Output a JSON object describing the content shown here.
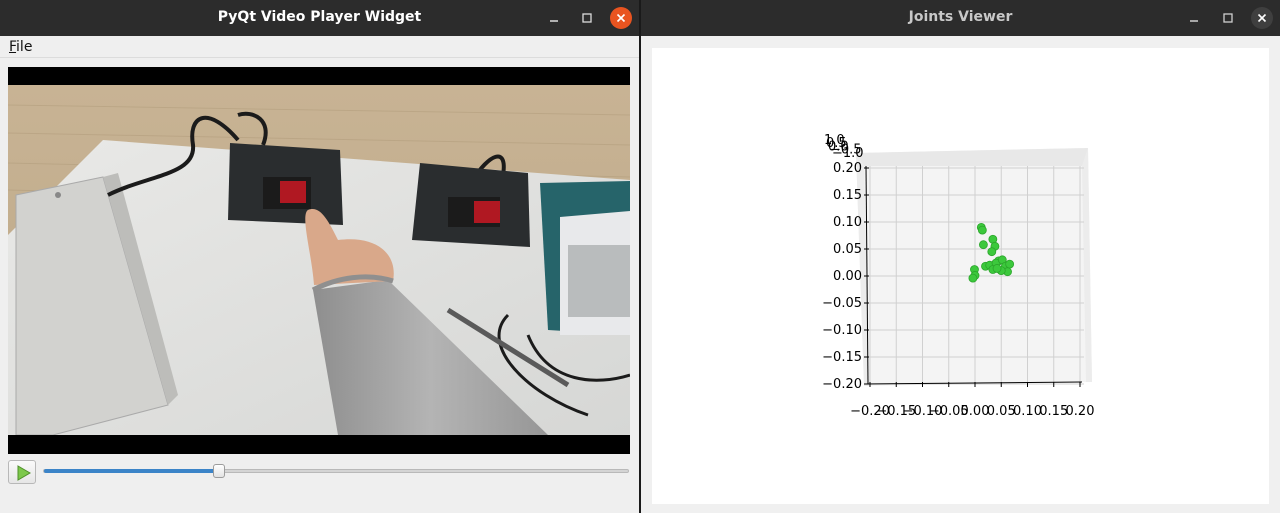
{
  "video_window": {
    "title": "PyQt Video Player Widget",
    "menu": {
      "file_prefix": "F",
      "file_rest": "ile"
    },
    "controls": {
      "play_icon": "play-icon",
      "progress": 0.3
    },
    "window_buttons": [
      "minimize-icon",
      "maximize-icon",
      "close-icon"
    ]
  },
  "joints_window": {
    "title": "Joints Viewer",
    "window_buttons": [
      "minimize-icon",
      "maximize-icon",
      "close-icon"
    ]
  },
  "chart_data": {
    "type": "scatter",
    "title": "",
    "xlabel": "",
    "ylabel": "",
    "xlim": [
      -0.2,
      0.2
    ],
    "ylim": [
      -0.2,
      0.2
    ],
    "grid": true,
    "marker_color": "#3cc83c",
    "x_ticks": [
      "−0.20",
      "−0.15",
      "−0.10",
      "−0.05",
      "0.00",
      "0.05",
      "0.10",
      "0.15",
      "0.20"
    ],
    "y_ticks": [
      "0.20",
      "0.15",
      "0.10",
      "0.05",
      "0.00",
      "−0.05",
      "−0.10",
      "−0.15",
      "−0.20"
    ],
    "z_ticks": [
      "1.0",
      "0.5",
      "0.0",
      "−0.5",
      "−1.0"
    ],
    "points": [
      {
        "x": 0.012,
        "y": 0.09
      },
      {
        "x": 0.014,
        "y": 0.085
      },
      {
        "x": 0.016,
        "y": 0.058
      },
      {
        "x": 0.034,
        "y": 0.068
      },
      {
        "x": 0.038,
        "y": 0.055
      },
      {
        "x": 0.032,
        "y": 0.045
      },
      {
        "x": 0.02,
        "y": 0.018
      },
      {
        "x": 0.028,
        "y": 0.02
      },
      {
        "x": 0.045,
        "y": 0.028
      },
      {
        "x": 0.04,
        "y": 0.024
      },
      {
        "x": 0.052,
        "y": 0.03
      },
      {
        "x": 0.058,
        "y": 0.018
      },
      {
        "x": 0.066,
        "y": 0.022
      },
      {
        "x": 0.062,
        "y": 0.008
      },
      {
        "x": 0.05,
        "y": 0.01
      },
      {
        "x": 0.034,
        "y": 0.012
      },
      {
        "x": 0.042,
        "y": 0.014
      },
      {
        "x": -0.001,
        "y": 0.012
      },
      {
        "x": 0.0,
        "y": 0.001
      },
      {
        "x": -0.004,
        "y": -0.004
      }
    ]
  }
}
